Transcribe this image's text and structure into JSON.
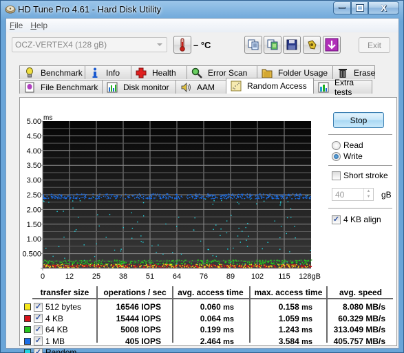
{
  "window": {
    "title": "HD Tune Pro 4.61 - Hard Disk Utility",
    "controls": {
      "minimize": "minimize",
      "maximize": "maximize",
      "close": "X"
    }
  },
  "menu": [
    {
      "label": "File",
      "accel": "F",
      "rest": "ile"
    },
    {
      "label": "Help",
      "accel": "H",
      "rest": "elp"
    }
  ],
  "toolbar": {
    "drive": "OCZ-VERTEX4 (128 gB)",
    "temperature": "– °C",
    "icons": [
      "copy-text-icon",
      "copy-screenshot-icon",
      "save-icon",
      "options-icon",
      "download-icon"
    ],
    "exit_label": "Exit"
  },
  "tabs": {
    "row1": [
      {
        "label": "Benchmark",
        "icon": "bulb-icon"
      },
      {
        "label": "Info",
        "icon": "info-icon"
      },
      {
        "label": "Health",
        "icon": "health-cross-icon"
      },
      {
        "label": "Error Scan",
        "icon": "magnifier-icon"
      },
      {
        "label": "Folder Usage",
        "icon": "folder-icon"
      },
      {
        "label": "Erase",
        "icon": "trash-icon"
      }
    ],
    "row2": [
      {
        "label": "File Benchmark",
        "icon": "file-benchmark-icon"
      },
      {
        "label": "Disk monitor",
        "icon": "disk-monitor-icon"
      },
      {
        "label": "AAM",
        "icon": "speaker-icon"
      },
      {
        "label": "Random Access",
        "icon": "scatter-icon",
        "active": true
      },
      {
        "label": "Extra tests",
        "icon": "extra-tests-icon"
      }
    ]
  },
  "controls": {
    "stop_label": "Stop",
    "read_label": "Read",
    "write_label": "Write",
    "mode": "Write",
    "short_stroke_label": "Short stroke",
    "short_stroke_checked": false,
    "short_stroke_value": "40",
    "short_stroke_unit": "gB",
    "align_label": "4 KB align",
    "align_checked": true
  },
  "results": {
    "headers": [
      "transfer size",
      "operations / sec",
      "avg. access time",
      "max. access time",
      "avg. speed"
    ],
    "rows": [
      {
        "label": "512 bytes",
        "color": "#f5e61c",
        "checked": true,
        "ops": "16546 IOPS",
        "avg": "0.060",
        "max": "0.158",
        "speed": "8.080 MB/s"
      },
      {
        "label": "4 KB",
        "color": "#d8141c",
        "checked": true,
        "ops": "15444 IOPS",
        "avg": "0.064",
        "max": "1.059",
        "speed": "60.329 MB/s"
      },
      {
        "label": "64 KB",
        "color": "#27c41f",
        "checked": true,
        "ops": "5008 IOPS",
        "avg": "0.199",
        "max": "1.243",
        "speed": "313.049 MB/s"
      },
      {
        "label": "1 MB",
        "color": "#1c6ee6",
        "checked": true,
        "ops": "405 IOPS",
        "avg": "2.464",
        "max": "3.584",
        "speed": "405.757 MB/s"
      },
      {
        "label": "Random",
        "color": "#22d4e0",
        "checked": true
      }
    ],
    "time_unit": "ms"
  },
  "chart_data": {
    "type": "scatter",
    "title": "",
    "ylabel": "ms",
    "xlabel": "gB",
    "ylim": [
      0,
      5.0
    ],
    "xlim": [
      0,
      128
    ],
    "y_ticks": [
      "5.00",
      "4.50",
      "4.00",
      "3.50",
      "3.00",
      "2.50",
      "2.00",
      "1.50",
      "1.00",
      "0.500"
    ],
    "y_tick_values": [
      5.0,
      4.5,
      4.0,
      3.5,
      3.0,
      2.5,
      2.0,
      1.5,
      1.0,
      0.5
    ],
    "x_ticks": [
      "0",
      "12",
      "25",
      "38",
      "51",
      "64",
      "76",
      "89",
      "102",
      "115",
      "128gB"
    ],
    "x_tick_values": [
      0,
      12.8,
      25.6,
      38.4,
      51.2,
      64,
      76.8,
      89.6,
      102.4,
      115.2,
      128
    ],
    "grid": true,
    "series": [
      {
        "name": "512 bytes",
        "color": "#f5e61c",
        "mean_ms": 0.06,
        "max_ms": 0.158,
        "band": [
          0.03,
          0.16
        ]
      },
      {
        "name": "4 KB",
        "color": "#d8141c",
        "mean_ms": 0.064,
        "max_ms": 1.059,
        "band": [
          0.05,
          0.14
        ]
      },
      {
        "name": "64 KB",
        "color": "#27c41f",
        "mean_ms": 0.199,
        "max_ms": 1.243,
        "band": [
          0.15,
          0.3
        ]
      },
      {
        "name": "1 MB",
        "color": "#1c6ee6",
        "mean_ms": 2.464,
        "max_ms": 3.584,
        "band": [
          2.38,
          2.55
        ]
      },
      {
        "name": "Random",
        "color": "#22d4e0",
        "band": [
          0.1,
          2.5
        ]
      }
    ]
  }
}
